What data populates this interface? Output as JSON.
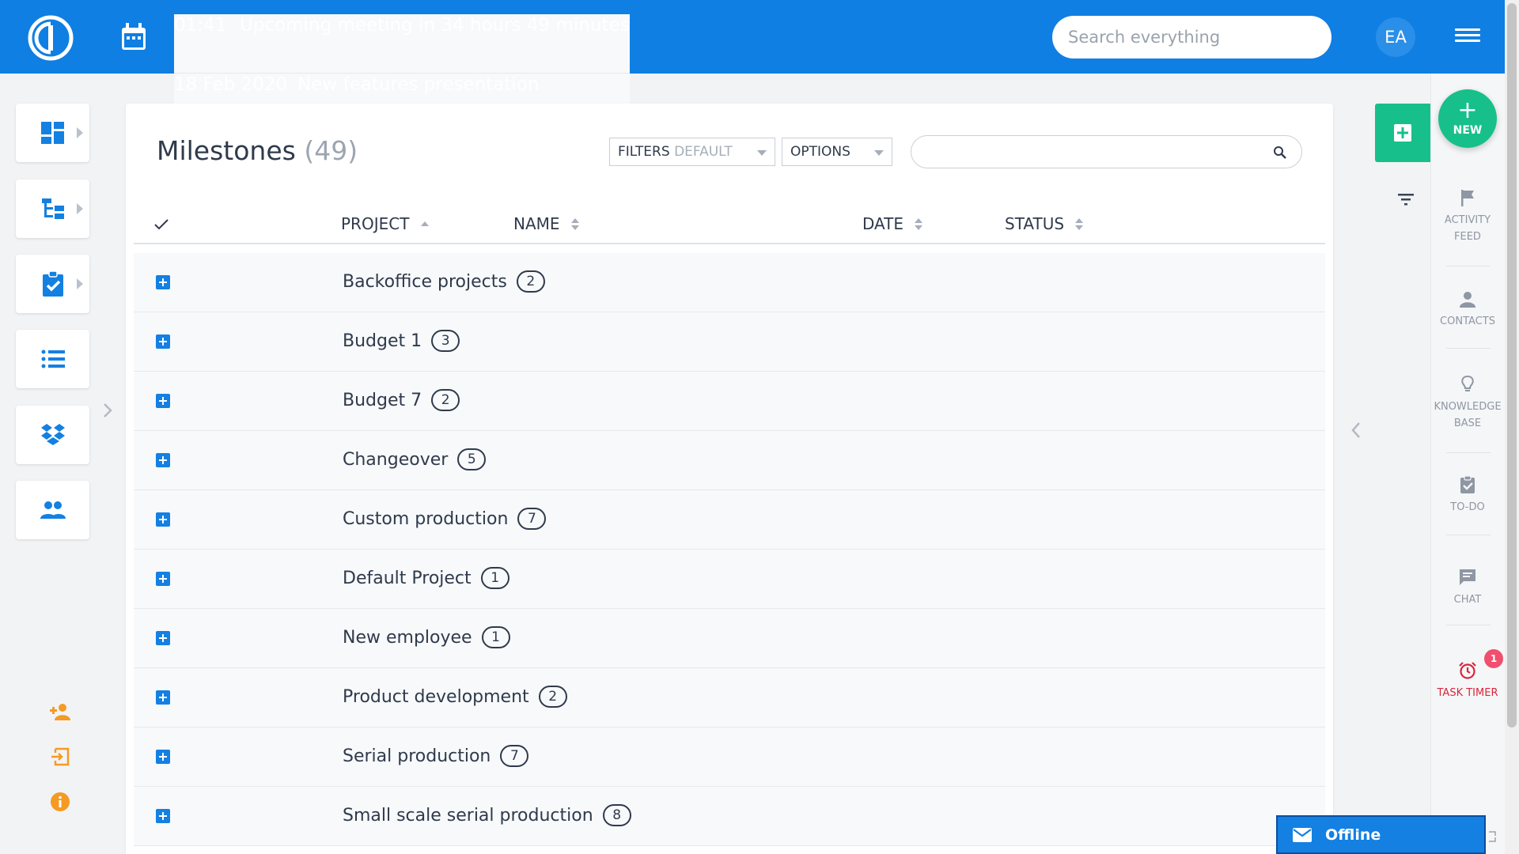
{
  "header": {
    "meeting_time": "01:41",
    "meeting_text": "Upcoming meeting in 34 hours 49 minutes",
    "meeting_date": "18 Feb 2020",
    "meeting_title": "New features presentation",
    "search_placeholder": "Search everything",
    "avatar_initials": "EA"
  },
  "left_rail": {
    "items": [
      {
        "icon": "dashboard-icon"
      },
      {
        "icon": "project-tree-icon"
      },
      {
        "icon": "task-clipboard-icon"
      },
      {
        "icon": "list-icon"
      },
      {
        "icon": "dropbox-icon"
      },
      {
        "icon": "users-icon"
      }
    ],
    "bottom_icons": [
      "add-user-icon",
      "logout-icon",
      "info-icon"
    ]
  },
  "main": {
    "title": "Milestones",
    "count": "(49)",
    "filters_label": "FILTERS",
    "filters_value": "DEFAULT",
    "options_label": "OPTIONS",
    "columns": {
      "project": "PROJECT",
      "name": "NAME",
      "date": "DATE",
      "status": "STATUS"
    },
    "rows": [
      {
        "project": "Backoffice projects",
        "count": "2"
      },
      {
        "project": "Budget 1",
        "count": "3"
      },
      {
        "project": "Budget 7",
        "count": "2"
      },
      {
        "project": "Changeover",
        "count": "5"
      },
      {
        "project": "Custom production",
        "count": "7"
      },
      {
        "project": "Default Project",
        "count": "1"
      },
      {
        "project": "New employee",
        "count": "1"
      },
      {
        "project": "Product development",
        "count": "2"
      },
      {
        "project": "Serial production",
        "count": "7"
      },
      {
        "project": "Small scale serial production",
        "count": "8"
      }
    ]
  },
  "right_rail": {
    "new_label": "NEW",
    "activity_feed_1": "ACTIVITY",
    "activity_feed_2": "FEED",
    "contacts": "CONTACTS",
    "knowledge_1": "KNOWLEDGE",
    "knowledge_2": "BASE",
    "todo": "TO-DO",
    "chat": "CHAT",
    "task_timer": "TASK TIMER",
    "task_timer_badge": "1"
  },
  "chat_widget": {
    "status": "Offline"
  },
  "colors": {
    "header_blue": "#0f7fe3",
    "accent_green": "#17c08a",
    "badge_red": "#f04f6e",
    "timer_red": "#d9263b",
    "orange_icons": "#f59a23"
  }
}
